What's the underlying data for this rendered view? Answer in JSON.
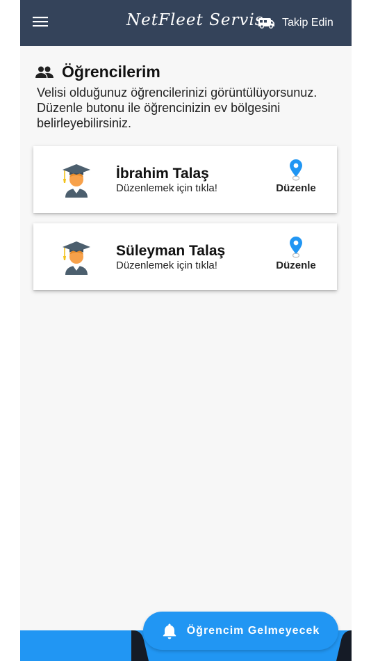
{
  "header": {
    "menu_icon": "hamburger-menu-icon",
    "brand": "NetFleet Servis",
    "follow_label": "Takip Edin",
    "follow_icon": "bus-icon",
    "bg_color": "#34435a"
  },
  "section": {
    "icon": "people-icon",
    "title": "Öğrencilerim",
    "description": "Velisi olduğunuz öğrencilerinizi görüntülüyorsunuz. Düzenle butonu ile öğrencinizin ev bölgesini belirleyebilirsiniz."
  },
  "students": [
    {
      "name": "İbrahim Talaş",
      "hint": "Düzenlemek için tıkla!",
      "edit_label": "Düzenle",
      "avatar": "graduate-student-icon"
    },
    {
      "name": "Süleyman Talaş",
      "hint": "Düzenlemek için tıkla!",
      "edit_label": "Düzenle",
      "avatar": "graduate-student-icon"
    }
  ],
  "fab": {
    "label": "Öğrencim Gelmeyecek",
    "icon": "bell-icon",
    "color": "#2196f3"
  }
}
